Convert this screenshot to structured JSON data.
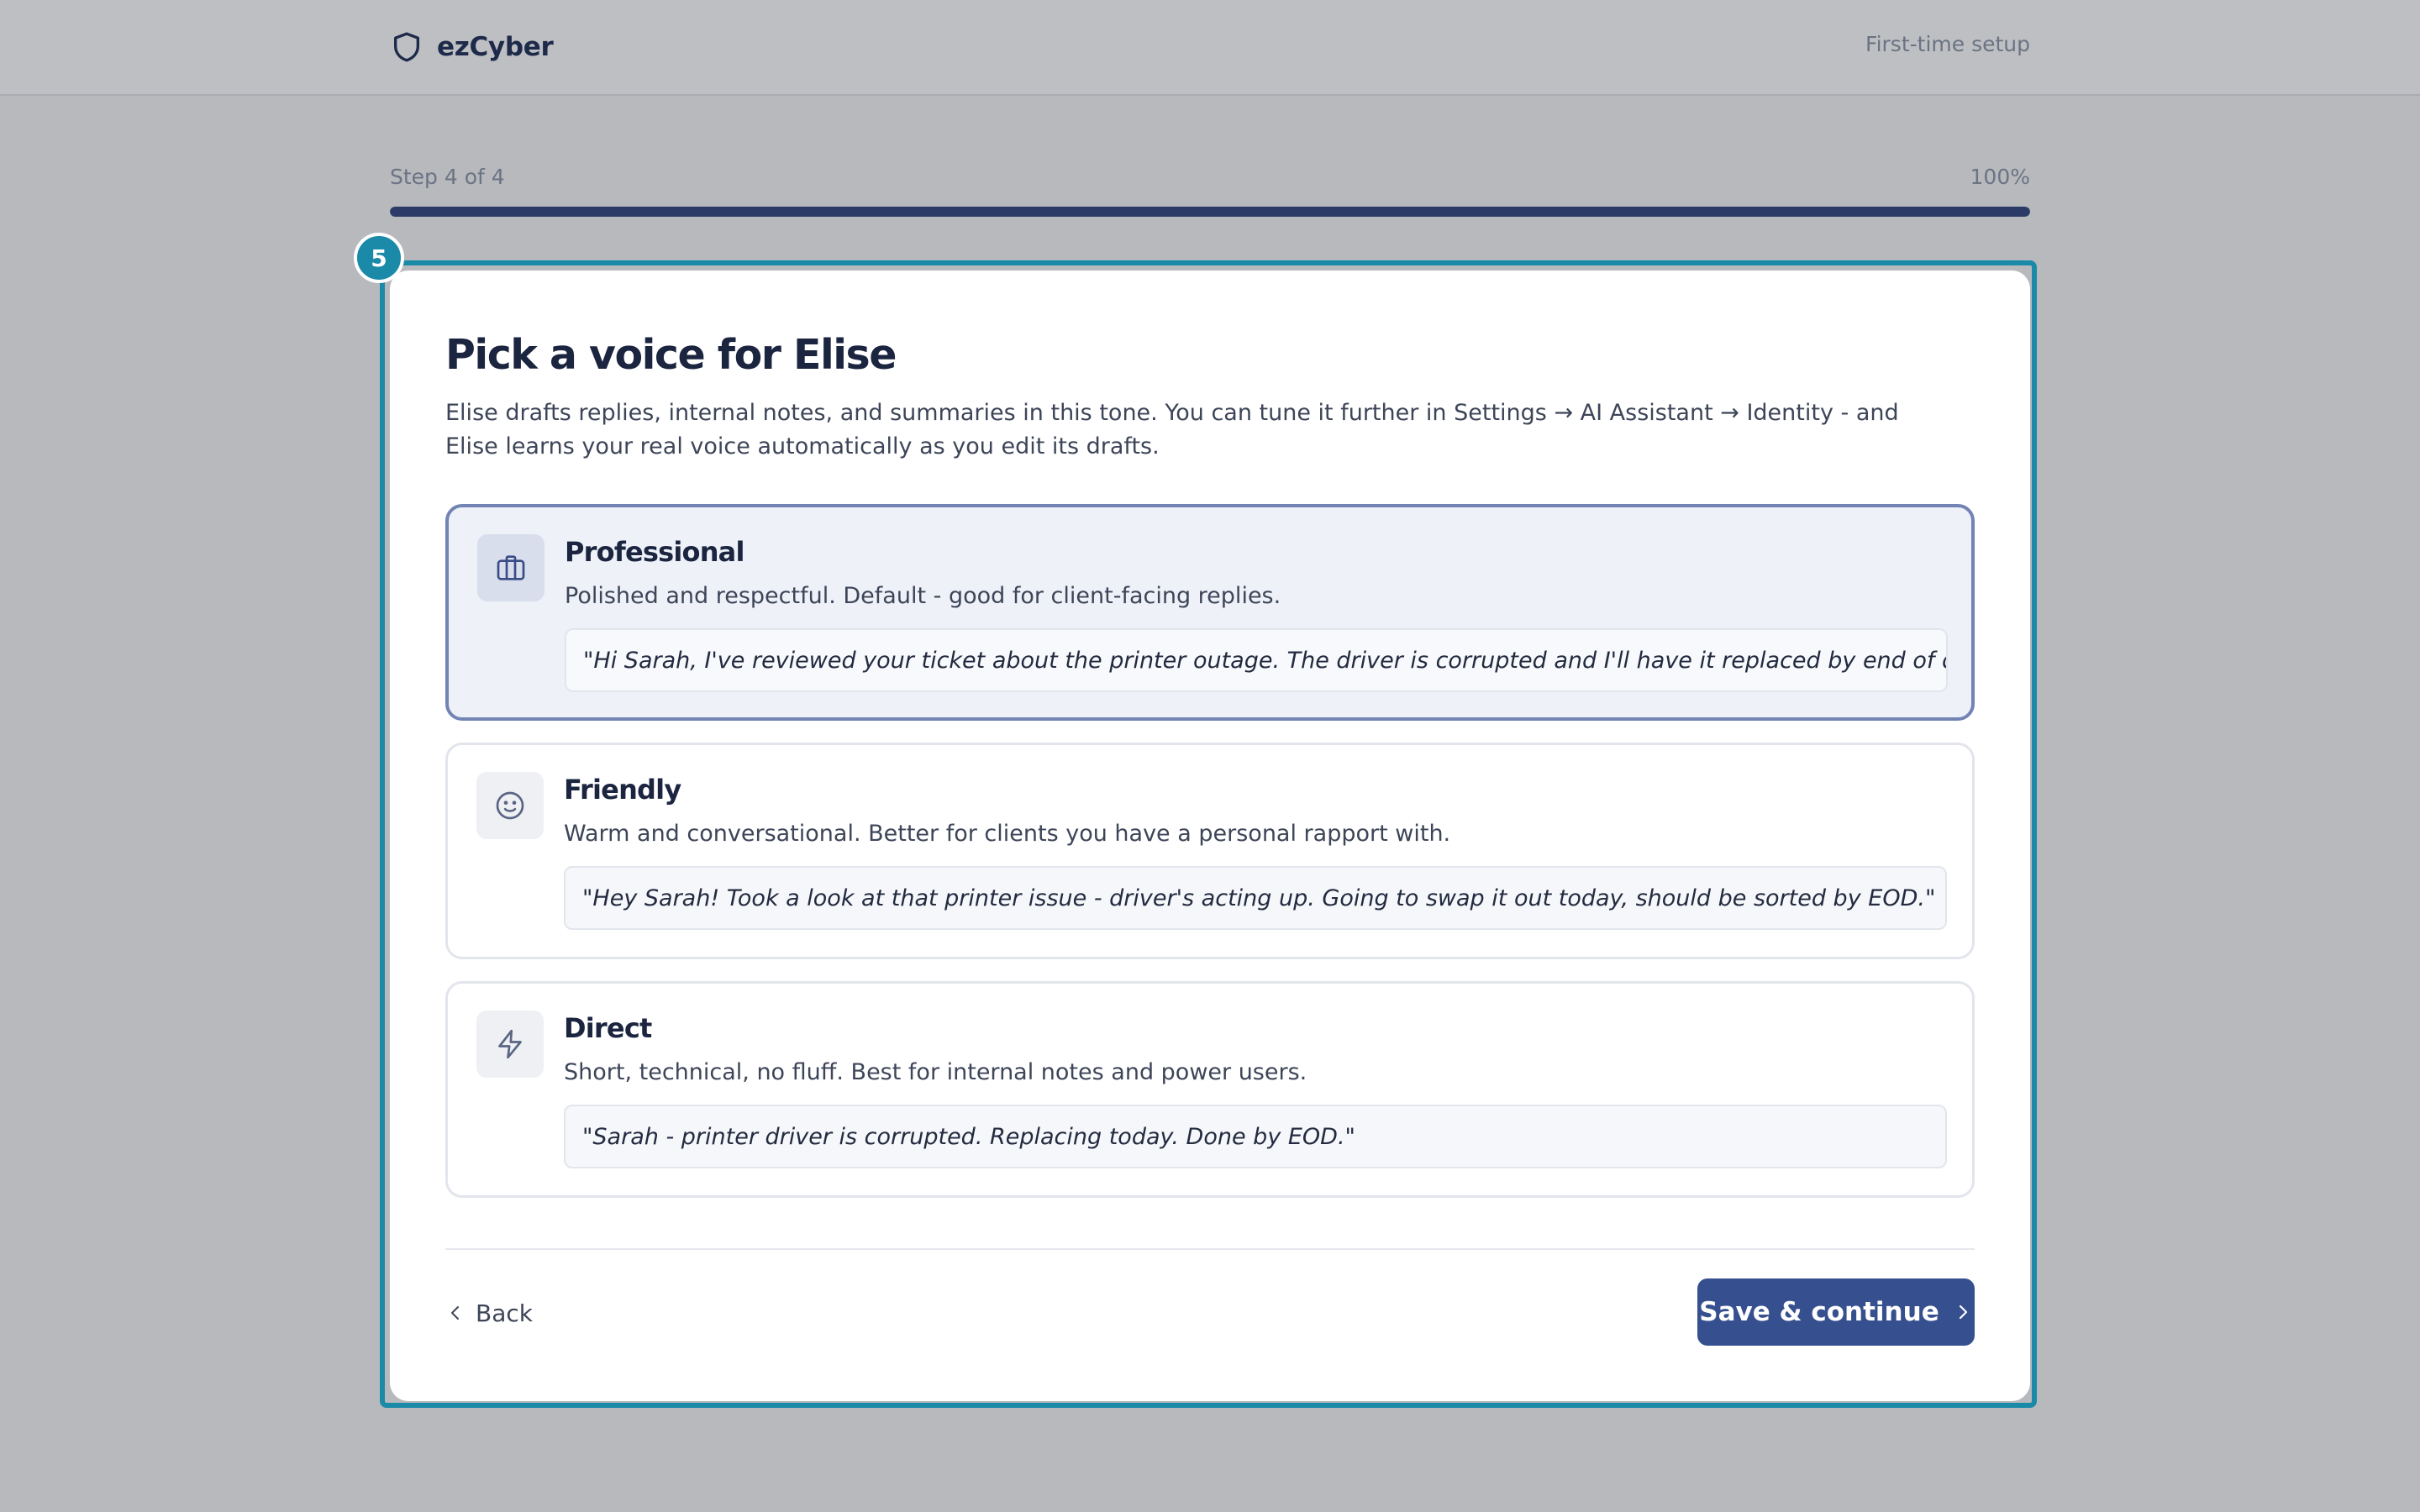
{
  "header": {
    "brand_name": "ezCyber",
    "brand_icon": "shield-icon",
    "setup_label": "First-time setup"
  },
  "progress": {
    "step_text": "Step 4 of 4",
    "percent_text": "100%",
    "percent_value": 100
  },
  "walkthrough": {
    "badge_number": "5",
    "highlight_color": "#1a8aa8"
  },
  "card": {
    "title": "Pick a voice for Elise",
    "description": "Elise drafts replies, internal notes, and summaries in this tone. You can tune it further in Settings → AI Assistant → Identity - and Elise learns your real voice automatically as you edit its drafts.",
    "options": [
      {
        "id": "professional",
        "title": "Professional",
        "subtitle": "Polished and respectful. Default - good for client-facing replies.",
        "example": "\"Hi Sarah, I've reviewed your ticket about the printer outage. The driver is corrupted and I'll have it replaced by end of day.\"",
        "icon": "briefcase-icon",
        "selected": true
      },
      {
        "id": "friendly",
        "title": "Friendly",
        "subtitle": "Warm and conversational. Better for clients you have a personal rapport with.",
        "example": "\"Hey Sarah! Took a look at that printer issue - driver's acting up. Going to swap it out today, should be sorted by EOD.\"",
        "icon": "smiley-icon",
        "selected": false
      },
      {
        "id": "direct",
        "title": "Direct",
        "subtitle": "Short, technical, no fluff. Best for internal notes and power users.",
        "example": "\"Sarah - printer driver is corrupted. Replacing today. Done by EOD.\"",
        "icon": "lightning-icon",
        "selected": false
      }
    ],
    "back_label": "Back",
    "save_label": "Save & continue"
  },
  "colors": {
    "primary": "#36508f",
    "progress": "#2b3a67",
    "selected_border": "#7383b4",
    "selected_bg": "#eef1f8",
    "accent": "#1a8aa8"
  }
}
